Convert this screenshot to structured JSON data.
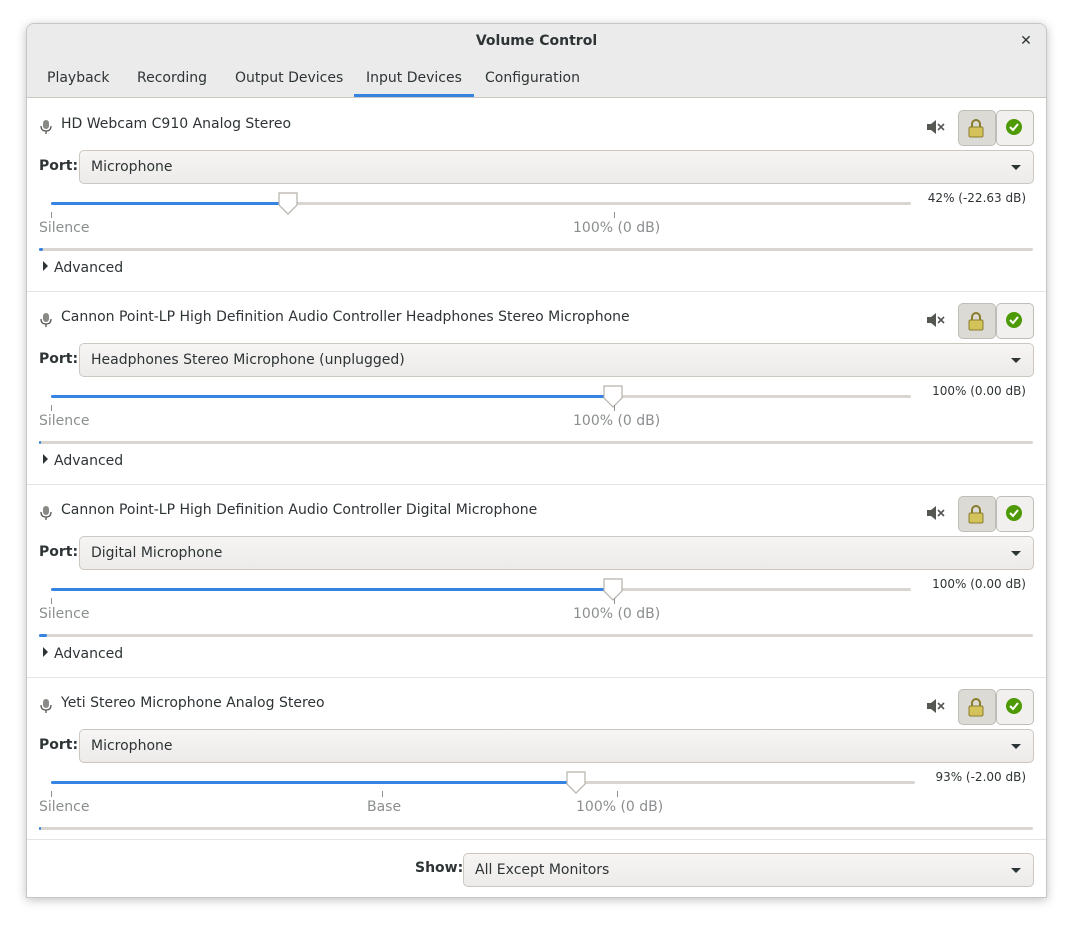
{
  "window": {
    "title": "Volume Control"
  },
  "tabs": [
    {
      "label": "Playback",
      "active": false
    },
    {
      "label": "Recording",
      "active": false
    },
    {
      "label": "Output Devices",
      "active": false
    },
    {
      "label": "Input Devices",
      "active": true
    },
    {
      "label": "Configuration",
      "active": false
    }
  ],
  "labels": {
    "port": "Port:",
    "advanced": "Advanced",
    "silence": "Silence",
    "hundred": "100% (0 dB)",
    "base": "Base"
  },
  "devices": [
    {
      "name": "HD Webcam C910 Analog Stereo",
      "port": "Microphone",
      "volume_text": "42% (-22.63 dB)",
      "volume_fraction": 0.275,
      "peak_fraction": 0.004,
      "show_base": false,
      "show_advanced": true
    },
    {
      "name": "Cannon Point-LP High Definition Audio Controller Headphones Stereo Microphone",
      "port": "Headphones Stereo Microphone (unplugged)",
      "volume_text": "100% (0.00 dB)",
      "volume_fraction": 0.654,
      "peak_fraction": 0.002,
      "show_base": false,
      "show_advanced": true
    },
    {
      "name": "Cannon Point-LP High Definition Audio Controller Digital Microphone",
      "port": "Digital Microphone",
      "volume_text": "100% (0.00 dB)",
      "volume_fraction": 0.654,
      "peak_fraction": 0.008,
      "show_base": false,
      "show_advanced": true
    },
    {
      "name": "Yeti Stereo Microphone Analog Stereo",
      "port": "Microphone",
      "volume_text": "93% (-2.00 dB)",
      "volume_fraction": 0.608,
      "peak_fraction": 0.002,
      "show_base": true,
      "show_advanced": false
    }
  ],
  "footer": {
    "show_label": "Show:",
    "show_value": "All Except Monitors"
  },
  "colors": {
    "accent": "#3584e4",
    "check_green": "#4e9a06",
    "lock_yellow": "#d4c25a"
  }
}
